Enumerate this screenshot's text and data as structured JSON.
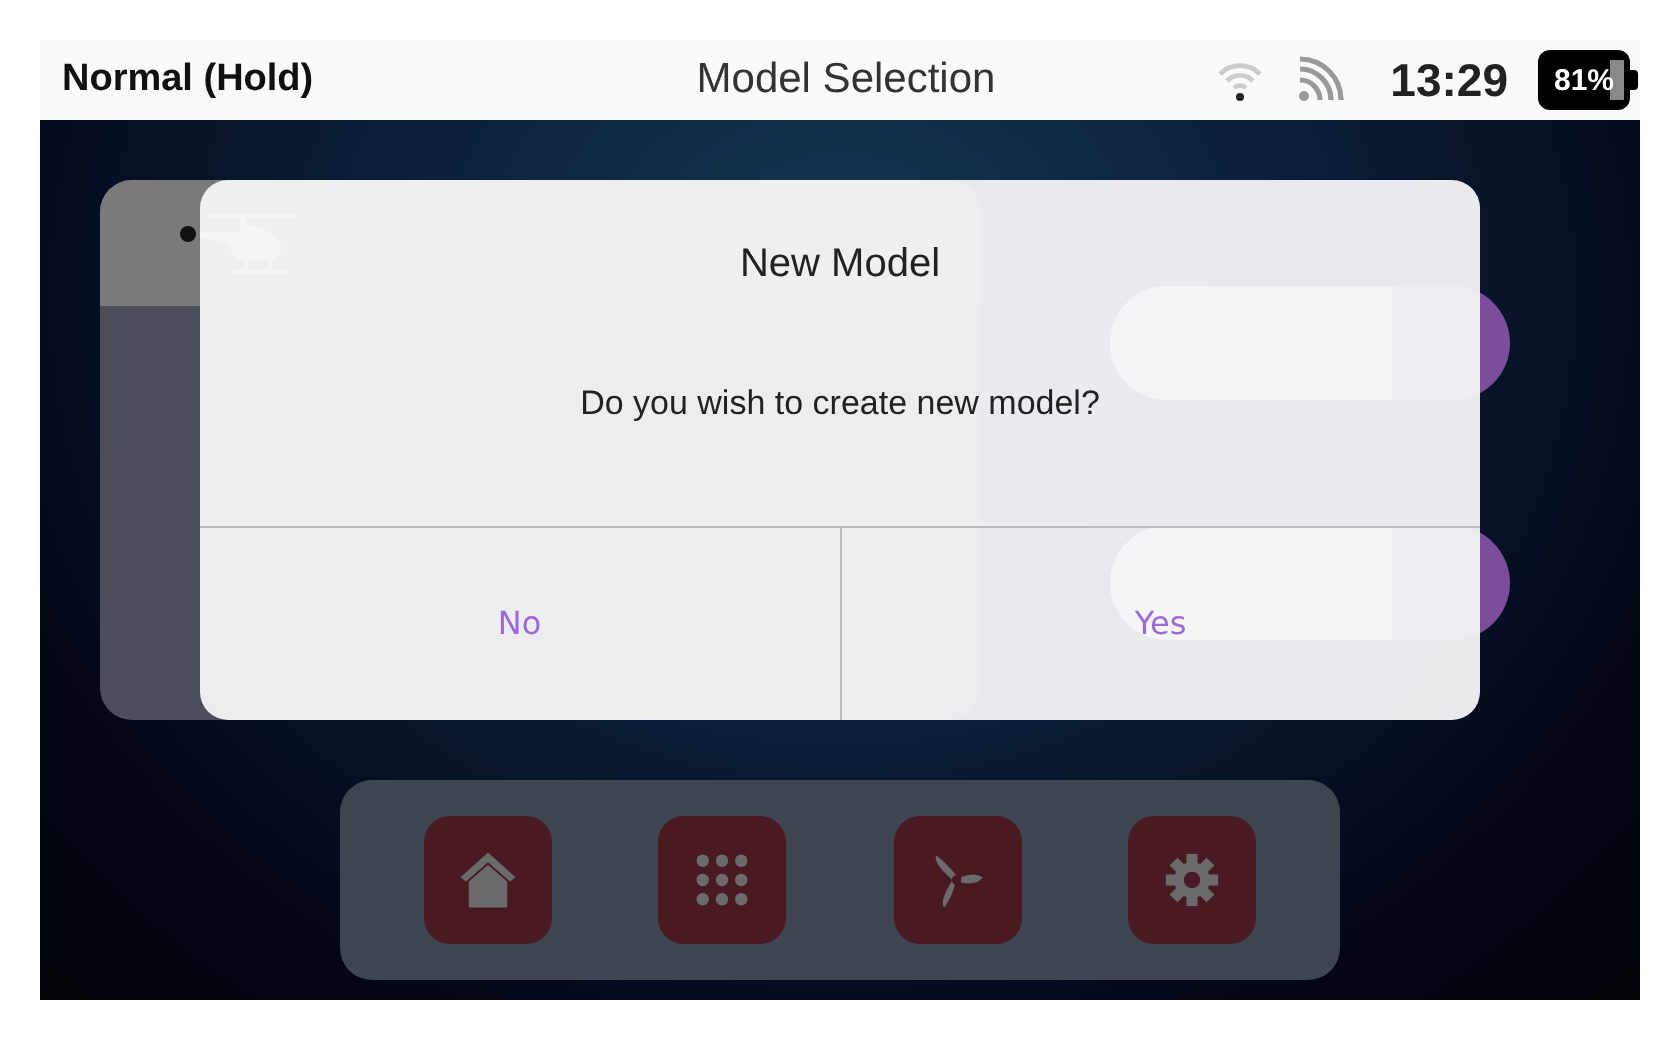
{
  "status_bar": {
    "mode": "Normal (Hold)",
    "title": "Model Selection",
    "time": "13:29",
    "battery": "81%"
  },
  "model_list": {
    "items": [
      {
        "selected": true
      }
    ]
  },
  "dock": [
    {
      "kind": "home"
    },
    {
      "kind": "apps"
    },
    {
      "kind": "fan"
    },
    {
      "kind": "settings"
    }
  ],
  "dialog": {
    "title": "New Model",
    "message": "Do you wish to create new model?",
    "buttons": [
      {
        "label": "No"
      },
      {
        "label": "Yes"
      }
    ]
  }
}
